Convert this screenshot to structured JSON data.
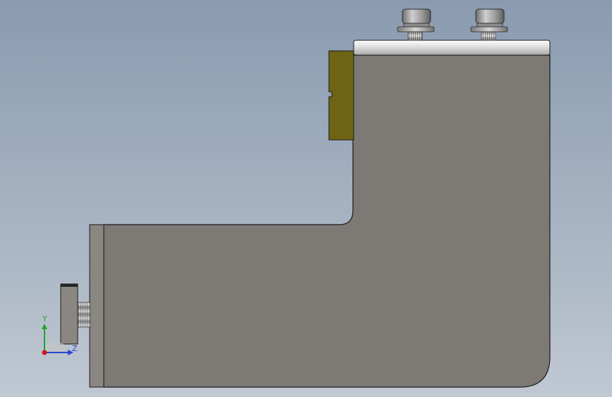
{
  "viewport": {
    "colors": {
      "background_top": "#8a9bb0",
      "background_bottom": "#c0c8d2",
      "part_body": "#7d7975",
      "part_outline": "#1a1a1a",
      "top_plate": "#e6e6e6",
      "bracket_olive": "#6e6414",
      "knob": "#9a9a9a"
    }
  },
  "triad": {
    "y_label": "Y",
    "z_label": "Z",
    "y_color": "#1fa52a",
    "z_color": "#2747c9",
    "x_color": "#d11414"
  }
}
